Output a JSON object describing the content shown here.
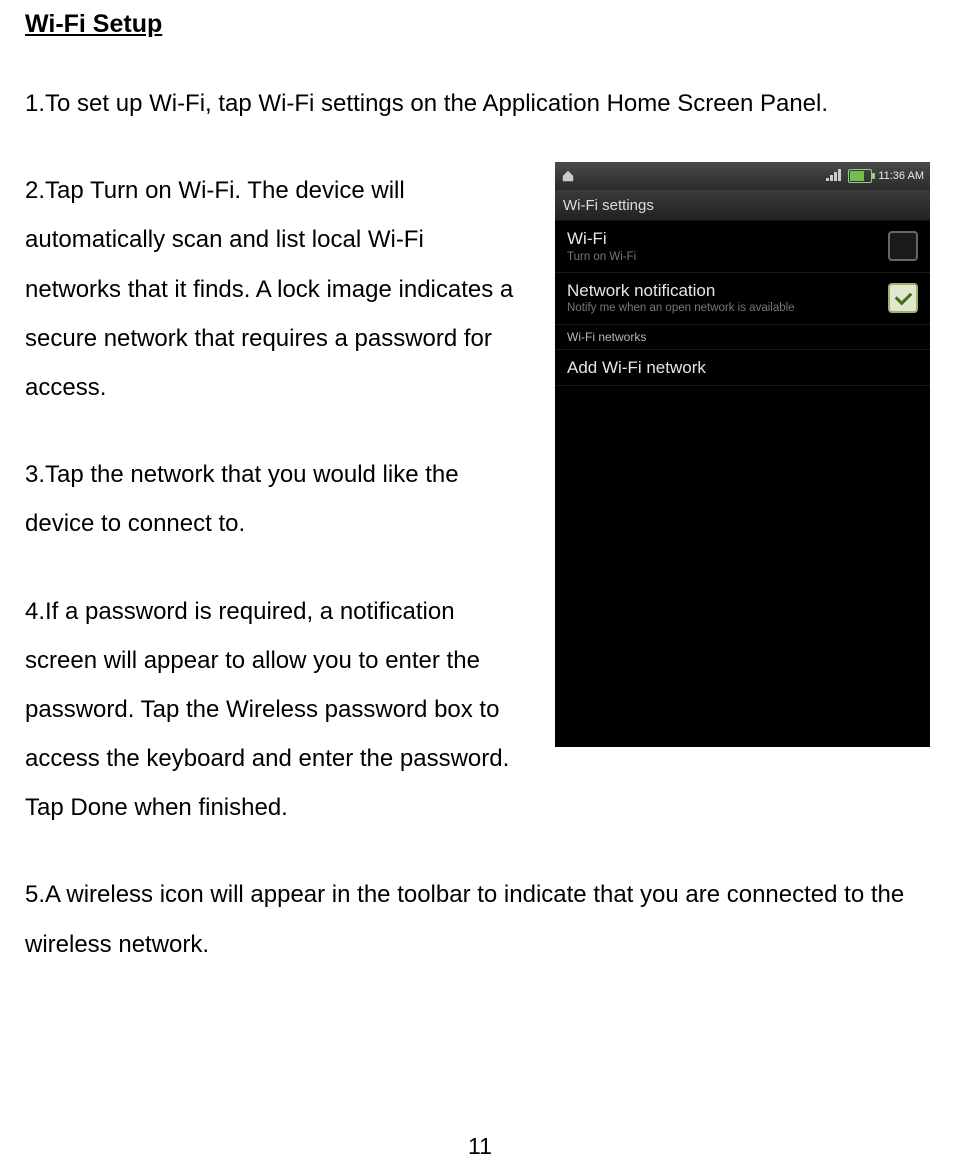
{
  "heading": "Wi-Fi Setup",
  "para1": "1.To set up Wi-Fi, tap Wi-Fi settings on the Application Home Screen Panel.",
  "para2": "2.Tap Turn on Wi-Fi. The device will automatically scan and list local Wi-Fi networks that it finds. A lock image indicates a secure network that requires a password for access.",
  "para3": "3.Tap the network that you would like the device to connect to.",
  "para4": "4.If a password is required, a notification screen will appear to allow you to enter the password. Tap the Wireless password box to access the keyboard and enter the password. Tap Done when finished.",
  "para5": "5.A wireless icon will appear in the toolbar to indicate that you are connected to the wireless network.",
  "page_number": "11",
  "screenshot": {
    "status_time": "11:36 AM",
    "title_bar": "Wi-Fi settings",
    "row_wifi_title": "Wi-Fi",
    "row_wifi_sub": "Turn on Wi-Fi",
    "row_notif_title": "Network notification",
    "row_notif_sub": "Notify me when an open network is available",
    "section_networks": "Wi-Fi networks",
    "row_add_title": "Add Wi-Fi network"
  }
}
